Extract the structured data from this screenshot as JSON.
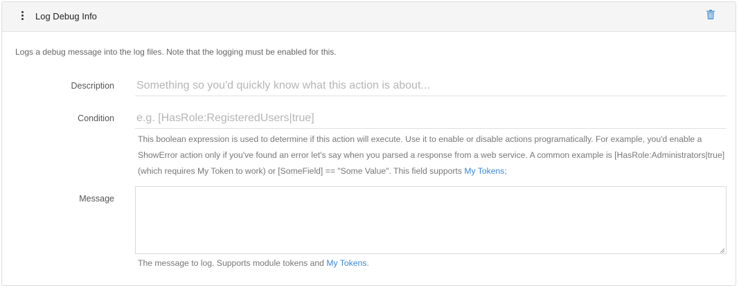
{
  "header": {
    "title": "Log Debug Info",
    "drag_icon": "vertical-ellipsis-icon",
    "delete_icon": "trash-icon"
  },
  "intro": "Logs a debug message into the log files. Note that the logging must be enabled for this.",
  "fields": {
    "description": {
      "label": "Description",
      "value": "",
      "placeholder": "Something so you'd quickly know what this action is about..."
    },
    "condition": {
      "label": "Condition",
      "value": "",
      "placeholder": "e.g. [HasRole:RegisteredUsers|true]",
      "help_part1": "This boolean expression is used to determine if this action will execute. Use it to enable or disable actions programatically. For example, you'd enable a ShowError action only if you've found an error let's say when you parsed a response from a web service. A common example is [HasRole:Administrators|true] (which requires My Token to work) or [SomeField] == \"Some Value\". This field supports ",
      "help_link": "My Tokens",
      "help_part2": ";"
    },
    "message": {
      "label": "Message",
      "value": "",
      "help_part1": "The message to log. Supports module tokens and ",
      "help_link": "My Tokens",
      "help_part2": "."
    }
  },
  "colors": {
    "link": "#3a87d8",
    "delete_icon": "#5b9bd5",
    "header_bg": "#f5f5f5"
  }
}
